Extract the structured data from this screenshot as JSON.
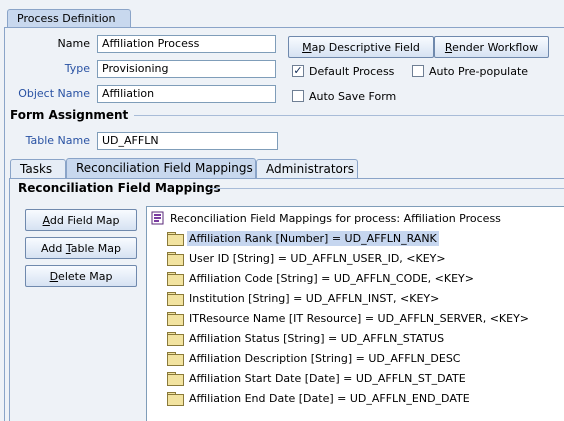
{
  "window": {
    "tab_label": "Process Definition"
  },
  "form": {
    "name_label": "Name",
    "name_value": "Affiliation Process",
    "type_label": "Type",
    "type_value": "Provisioning",
    "object_label": "Object Name",
    "object_value": "Affiliation",
    "map_descriptive_button": "Map Descriptive Field",
    "map_descriptive_mnemonic": "M",
    "map_descriptive_rest": "ap Descriptive Field",
    "render_workflow_button": "Render Workflow",
    "render_workflow_mnemonic": "R",
    "render_workflow_rest": "ender Workflow",
    "default_process_label": "Default Process",
    "default_process_checked": true,
    "auto_prepopulate_label": "Auto Pre-populate",
    "auto_prepopulate_checked": false,
    "auto_save_label": "Auto Save Form",
    "auto_save_checked": false
  },
  "form_assignment": {
    "title": "Form Assignment",
    "table_label": "Table Name",
    "table_value": "UD_AFFLN"
  },
  "tabs": [
    {
      "label": "Tasks",
      "active": false
    },
    {
      "label": "Reconciliation Field Mappings",
      "active": true
    },
    {
      "label": "Administrators",
      "active": false
    }
  ],
  "recon": {
    "title": "Reconciliation Field Mappings",
    "add_field_map": "Add Field Map",
    "add_field_map_pre": "",
    "add_field_map_mnemonic": "A",
    "add_field_map_post": "dd Field Map",
    "add_table_map": "Add Table Map",
    "add_table_map_pre": "Add ",
    "add_table_map_mnemonic": "T",
    "add_table_map_post": "able Map",
    "delete_map": "Delete Map",
    "delete_map_pre": "",
    "delete_map_mnemonic": "D",
    "delete_map_post": "elete Map",
    "tree_root": "Reconciliation Field Mappings for process: Affiliation Process",
    "items": [
      {
        "text": "Affiliation Rank [Number] = UD_AFFLN_RANK",
        "selected": true
      },
      {
        "text": "User ID [String] = UD_AFFLN_USER_ID, <KEY>",
        "selected": false
      },
      {
        "text": "Affiliation Code [String] = UD_AFFLN_CODE, <KEY>",
        "selected": false
      },
      {
        "text": "Institution [String] = UD_AFFLN_INST, <KEY>",
        "selected": false
      },
      {
        "text": "ITResource Name [IT Resource] = UD_AFFLN_SERVER, <KEY>",
        "selected": false
      },
      {
        "text": "Affiliation Status [String] = UD_AFFLN_STATUS",
        "selected": false
      },
      {
        "text": "Affiliation Description [String] = UD_AFFLN_DESC",
        "selected": false
      },
      {
        "text": "Affiliation Start Date [Date] = UD_AFFLN_ST_DATE",
        "selected": false
      },
      {
        "text": "Affiliation End Date [Date] = UD_AFFLN_END_DATE",
        "selected": false
      }
    ]
  },
  "colors": {
    "panel_bg": "#eef2f7",
    "accent_blue_label": "#2952a3",
    "selection": "#c6d6ef",
    "tab_active": "#c8d8ee"
  }
}
